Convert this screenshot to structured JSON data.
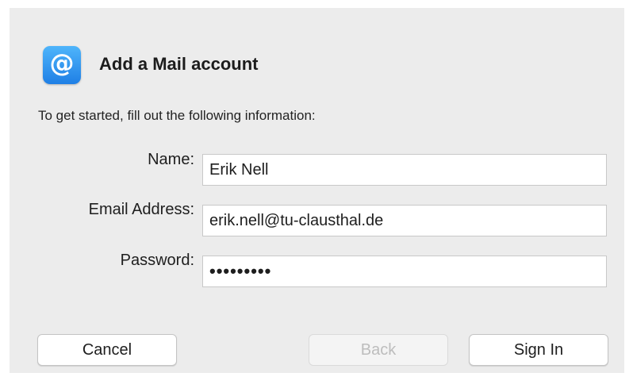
{
  "dialog": {
    "title": "Add a Mail account",
    "icon": "at-sign-icon",
    "icon_glyph": "@",
    "intro": "To get started, fill out the following information:"
  },
  "form": {
    "name_label": "Name:",
    "name_value": "Erik Nell",
    "email_label": "Email Address:",
    "email_value": "erik.nell@tu-clausthal.de",
    "password_label": "Password:",
    "password_value": "•••••••••"
  },
  "buttons": {
    "cancel": "Cancel",
    "back": "Back",
    "sign_in": "Sign In"
  },
  "colors": {
    "dialog_bg": "#ececec",
    "icon_blue": "#1f7fe5",
    "disabled_text": "#bdbdbd"
  }
}
